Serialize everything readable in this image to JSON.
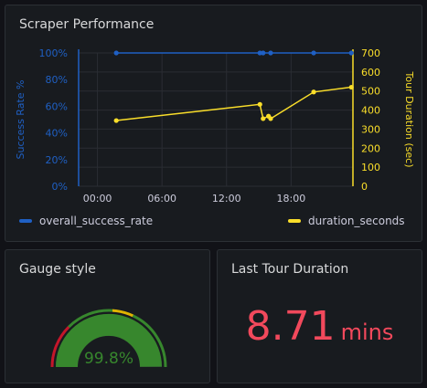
{
  "panels": {
    "performance": {
      "title": "Scraper Performance",
      "legend": [
        {
          "label": "overall_success_rate",
          "color": "#1f60c4"
        },
        {
          "label": "duration_seconds",
          "color": "#fade2a"
        }
      ]
    },
    "gauge": {
      "title": "Gauge style",
      "value": 99.8,
      "value_text": "99.8%",
      "colors": {
        "fill": "#37872d",
        "text": "#37872d",
        "thresholds": [
          "#c4162a",
          "#e0b400",
          "#37872d"
        ]
      }
    },
    "last_tour": {
      "title": "Last Tour Duration",
      "value": "8.71",
      "unit": "mins",
      "color": "#f2495c"
    }
  },
  "chart_data": {
    "type": "line",
    "x_tick_labels": [
      "00:00",
      "06:00",
      "12:00",
      "18:00"
    ],
    "left_axis": {
      "label": "Success Rate %",
      "ticks": [
        "0%",
        "20%",
        "40%",
        "60%",
        "80%",
        "100%"
      ],
      "ylim": [
        0,
        100
      ],
      "color": "#1f60c4"
    },
    "right_axis": {
      "label": "Tour Duration (sec)",
      "ticks": [
        "0",
        "100",
        "200",
        "300",
        "400",
        "500",
        "600",
        "700"
      ],
      "ylim": [
        0,
        700
      ],
      "color": "#fade2a"
    },
    "xlim_hours": [
      -1.75,
      23.75
    ],
    "grid": true,
    "series": [
      {
        "name": "overall_success_rate",
        "axis": "left",
        "color": "#1f60c4",
        "points": [
          [
            1.75,
            100
          ],
          [
            15.1,
            100
          ],
          [
            15.4,
            100
          ],
          [
            16.1,
            100
          ],
          [
            20.1,
            100
          ],
          [
            23.6,
            100
          ]
        ]
      },
      {
        "name": "duration_seconds",
        "axis": "right",
        "color": "#fade2a",
        "points": [
          [
            1.75,
            345
          ],
          [
            15.1,
            430
          ],
          [
            15.4,
            355
          ],
          [
            15.9,
            368
          ],
          [
            16.1,
            355
          ],
          [
            20.1,
            495
          ],
          [
            23.6,
            520
          ]
        ]
      }
    ]
  }
}
